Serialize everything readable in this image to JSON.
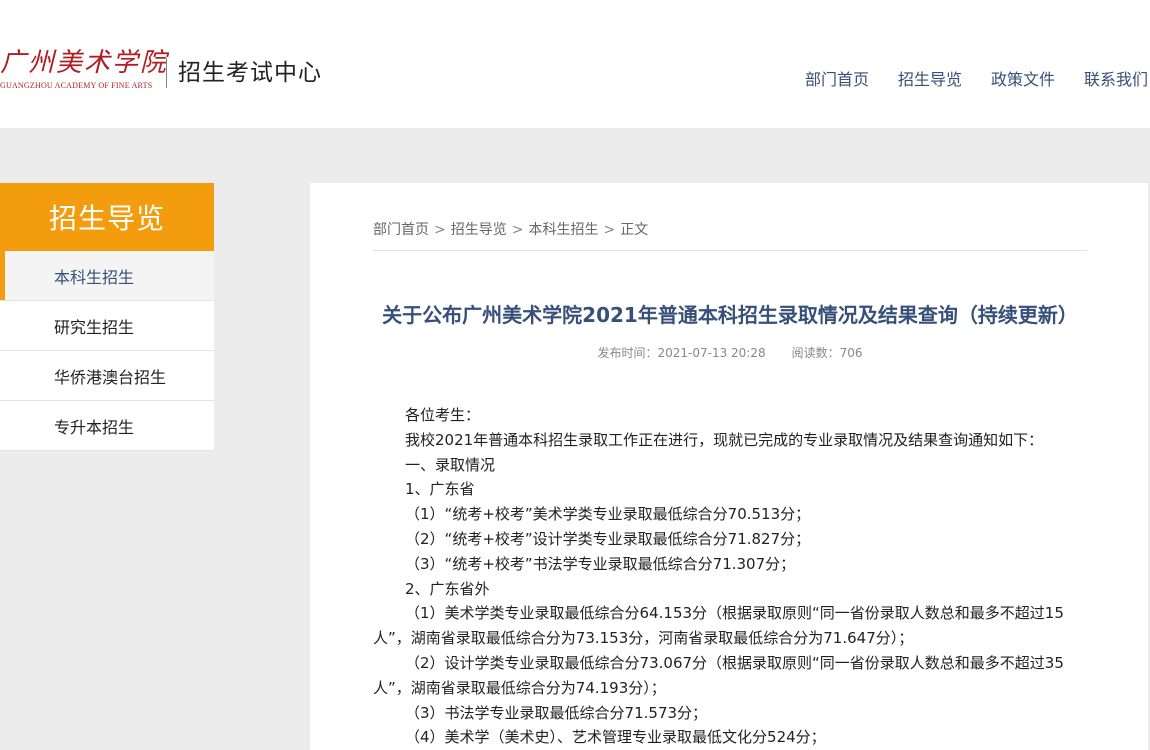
{
  "header": {
    "logo_script": "广州美术学院",
    "logo_en": "GUANGZHOU ACADEMY OF FINE ARTS",
    "site_title": "招生考试中心",
    "nav": [
      "部门首页",
      "招生导览",
      "政策文件",
      "联系我们"
    ]
  },
  "sidebar": {
    "title": "招生导览",
    "items": [
      "本科生招生",
      "研究生招生",
      "华侨港澳台招生",
      "专升本招生"
    ]
  },
  "article": {
    "breadcrumb": [
      "部门首页",
      "招生导览",
      "本科生招生",
      "正文"
    ],
    "breadcrumb_sep": ">",
    "title": "关于公布广州美术学院2021年普通本科招生录取情况及结果查询（持续更新）",
    "publish_time": "发布时间：2021-07-13 20:28",
    "views": "阅读数：706",
    "paragraphs": [
      "各位考生：",
      "我校2021年普通本科招生录取工作正在进行，现就已完成的专业录取情况及结果查询通知如下：",
      "一、录取情况",
      "1、广东省",
      "（1）“统考+校考”美术学类专业录取最低综合分70.513分；",
      "（2）“统考+校考”设计学类专业录取最低综合分71.827分；",
      "（3）“统考+校考”书法学专业录取最低综合分71.307分；",
      "2、广东省外",
      "（1）美术学类专业录取最低综合分64.153分（根据录取原则“同一省份录取人数总和最多不超过15人”，湖南省录取最低综合分为73.153分，河南省录取最低综合分为71.647分）；",
      "（2）设计学类专业录取最低综合分73.067分（根据录取原则“同一省份录取人数总和最多不超过35人”，湖南省录取最低综合分为74.193分）；",
      "（3）书法学专业录取最低综合分71.573分；",
      "（4）美术学（美术史）、艺术管理专业录取最低文化分524分；"
    ]
  }
}
